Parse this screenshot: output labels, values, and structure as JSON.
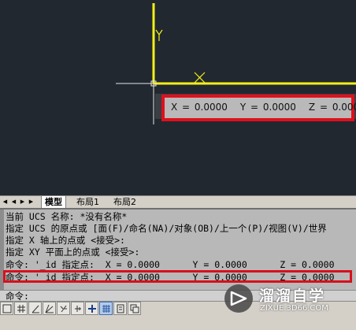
{
  "viewport": {
    "coordinate_tooltip": {
      "x_label": "X = 0.0000",
      "y_label": "Y = 0.0000",
      "z_label": "Z = 0.0000"
    },
    "ucs_y_label": "Y"
  },
  "layout_tabs": {
    "items": [
      {
        "label": "模型",
        "active": true
      },
      {
        "label": "布局1",
        "active": false
      },
      {
        "label": "布局2",
        "active": false
      }
    ]
  },
  "command_history": {
    "lines": [
      "当前 UCS 名称: *没有名称*",
      "指定 UCS 的原点或 [面(F)/命名(NA)/对象(OB)/上一个(P)/视图(V)/世界",
      "指定 X 轴上的点或 <接受>:",
      "指定 XY 平面上的点或 <接受>:",
      "命令: '_id 指定点:  X = 0.0000      Y = 0.0000      Z = 0.0000",
      "命令: '_id 指定点:  X = 0.0000      Y = 0.0000      Z = 0.0000"
    ],
    "prompt": "命令:"
  },
  "status_bar": {
    "buttons": [
      {
        "icon": "snap-icon",
        "on": false
      },
      {
        "icon": "grid-icon",
        "on": false
      },
      {
        "icon": "ortho-icon",
        "on": false
      },
      {
        "icon": "polar-icon",
        "on": false
      },
      {
        "icon": "osnap-icon",
        "on": false
      },
      {
        "icon": "otrack-icon",
        "on": false
      },
      {
        "icon": "crosshair-icon",
        "on": false
      },
      {
        "icon": "dyn-grid-icon",
        "on": true
      },
      {
        "icon": "lineweight-icon",
        "on": false
      },
      {
        "icon": "model-icon",
        "on": false
      }
    ]
  },
  "watermark": {
    "title": "溜溜自学",
    "url": "ZIXUE.3D66.COM"
  },
  "colors": {
    "viewport_bg": "#212830",
    "ucs_axis": "#f2ef1a",
    "highlight_box": "#e0101c",
    "command_bg": "#b8b8b8"
  }
}
